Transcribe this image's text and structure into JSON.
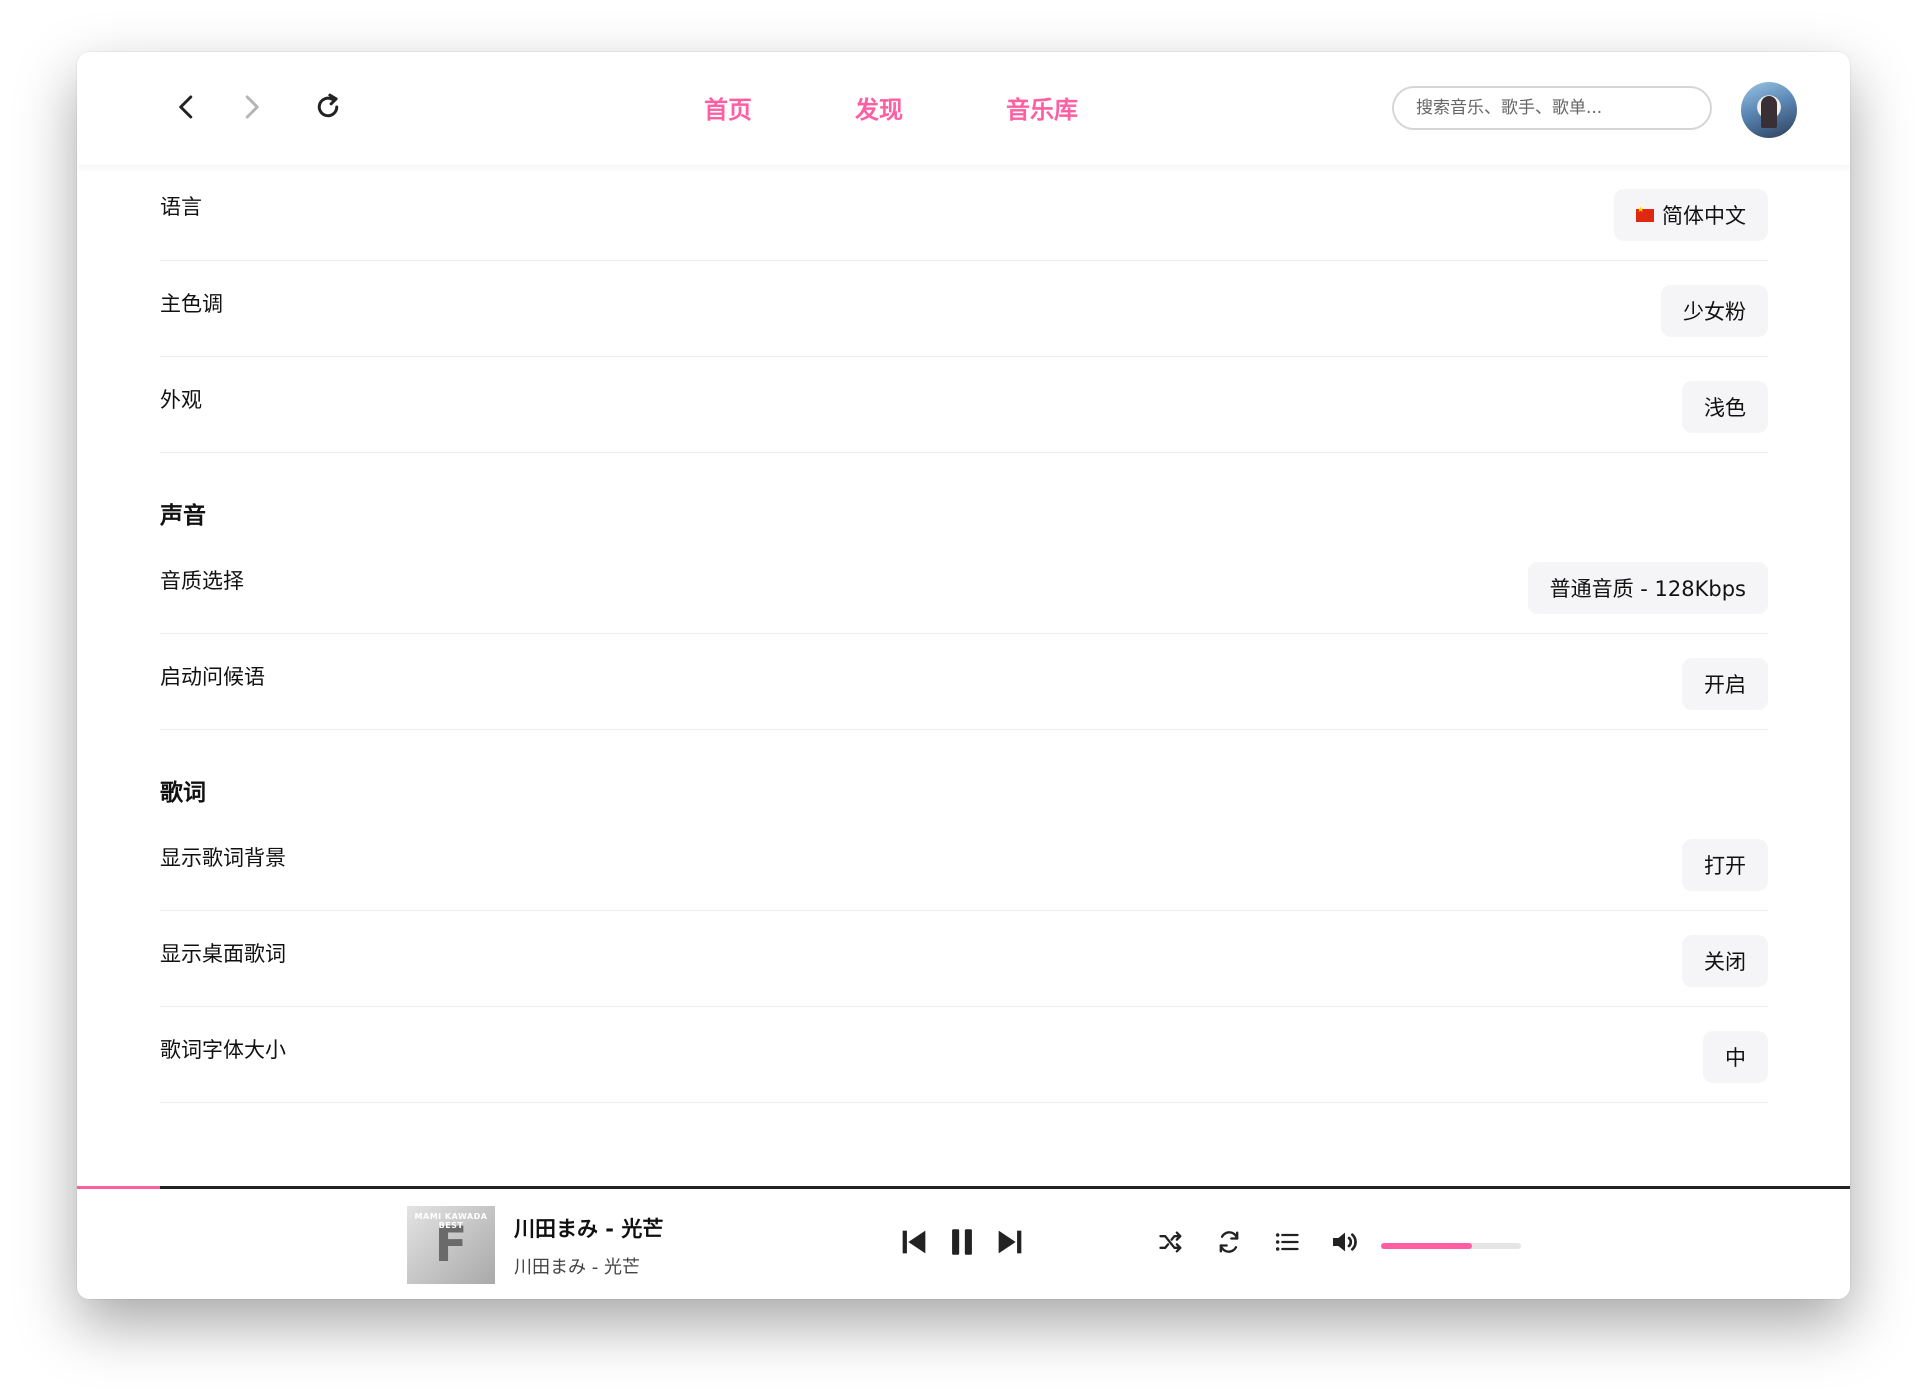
{
  "nav": {
    "links": [
      "首页",
      "发现",
      "音乐库"
    ],
    "search_placeholder": "搜索音乐、歌手、歌单..."
  },
  "settings": {
    "general": [
      {
        "label": "语言",
        "value": "简体中文",
        "flag": true
      },
      {
        "label": "主色调",
        "value": "少女粉"
      },
      {
        "label": "外观",
        "value": "浅色"
      }
    ],
    "sound_title": "声音",
    "sound": [
      {
        "label": "音质选择",
        "value": "普通音质 - 128Kbps"
      },
      {
        "label": "启动问候语",
        "value": "开启"
      }
    ],
    "lyrics_title": "歌词",
    "lyrics": [
      {
        "label": "显示歌词背景",
        "value": "打开"
      },
      {
        "label": "显示桌面歌词",
        "value": "关闭"
      },
      {
        "label": "歌词字体大小",
        "value": "中"
      }
    ]
  },
  "player": {
    "title": "川田まみ - 光芒",
    "artist": "川田まみ - 光芒",
    "cover_text": "MAMI KAWADA",
    "cover_sub": "BEST",
    "cover_letter": "F",
    "progress": 0.047,
    "volume": 0.65
  },
  "colors": {
    "accent": "#ff5ea2"
  }
}
